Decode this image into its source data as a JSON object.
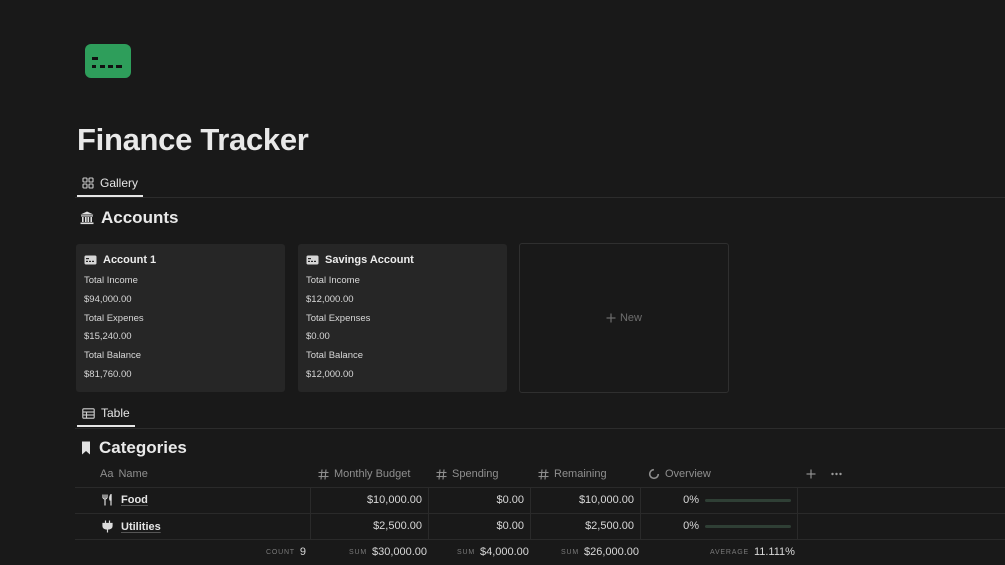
{
  "page": {
    "title": "Finance Tracker"
  },
  "accounts_view": {
    "tab_label": "Gallery",
    "section_title": "Accounts"
  },
  "accounts": [
    {
      "name": "Account 1",
      "income_label": "Total Income",
      "income": "$94,000.00",
      "expenses_label": "Total Expenes",
      "expenses": "$15,240.00",
      "balance_label": "Total Balance",
      "balance": "$81,760.00"
    },
    {
      "name": "Savings Account",
      "income_label": "Total Income",
      "income": "$12,000.00",
      "expenses_label": "Total Expenses",
      "expenses": "$0.00",
      "balance_label": "Total Balance",
      "balance": "$12,000.00"
    }
  ],
  "new_card_label": "New",
  "categories_view": {
    "tab_label": "Table",
    "section_title": "Categories"
  },
  "table": {
    "headers": {
      "name_prefix": "Aa",
      "name": "Name",
      "monthly_budget": "Monthly Budget",
      "spending": "Spending",
      "remaining": "Remaining",
      "overview": "Overview"
    },
    "rows": [
      {
        "icon": "fork-knife-icon",
        "name": "Food",
        "monthly_budget": "$10,000.00",
        "spending": "$0.00",
        "remaining": "$10,000.00",
        "overview": "0%",
        "progress": 0
      },
      {
        "icon": "plug-icon",
        "name": "Utilities",
        "monthly_budget": "$2,500.00",
        "spending": "$0.00",
        "remaining": "$2,500.00",
        "overview": "0%",
        "progress": 0
      }
    ],
    "footer": {
      "count_label": "COUNT",
      "count": "9",
      "budget_label": "SUM",
      "budget": "$30,000.00",
      "spending_label": "SUM",
      "spending": "$4,000.00",
      "remaining_label": "SUM",
      "remaining": "$26,000.00",
      "overview_label": "AVERAGE",
      "overview": "11.111%"
    }
  },
  "colors": {
    "background": "#191919",
    "page_icon": "#2e9e5b",
    "progress_track": "#2f3f35"
  }
}
